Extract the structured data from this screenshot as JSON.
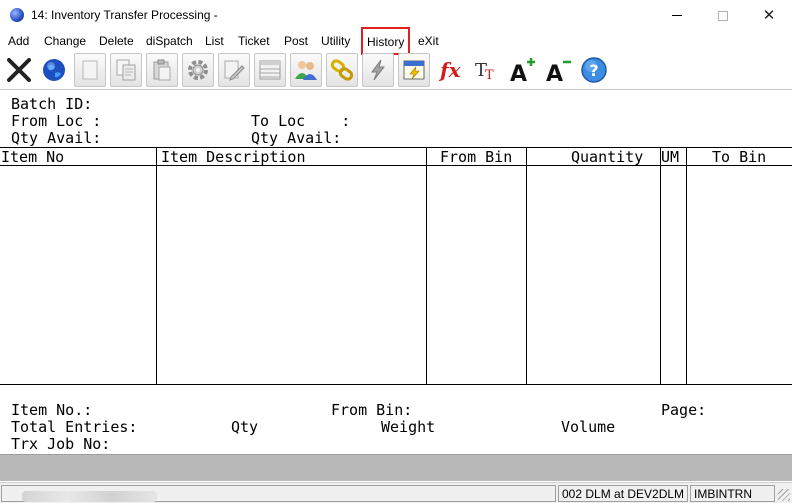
{
  "window": {
    "title": "14: Inventory Transfer Processing -",
    "minimize": "",
    "maximize": "",
    "close": "✕"
  },
  "menu": {
    "items": [
      {
        "label": "Add"
      },
      {
        "label": "Change"
      },
      {
        "label": "Delete"
      },
      {
        "label": "diSpatch"
      },
      {
        "label": "List"
      },
      {
        "label": "Ticket"
      },
      {
        "label": "Post"
      },
      {
        "label": "Utility"
      },
      {
        "label": "History",
        "highlighted": true
      },
      {
        "label": "eXit"
      }
    ]
  },
  "toolbar": {
    "buttons": [
      {
        "icon": "close-x-icon"
      },
      {
        "icon": "globe-icon"
      },
      {
        "icon": "blank-page-icon"
      },
      {
        "icon": "copy-icon"
      },
      {
        "icon": "paste-icon"
      },
      {
        "icon": "settings-gear-icon"
      },
      {
        "icon": "edit-pencil-icon"
      },
      {
        "icon": "grid-list-icon"
      },
      {
        "icon": "users-icon"
      },
      {
        "icon": "link-chain-icon"
      },
      {
        "icon": "lightning-icon"
      },
      {
        "icon": "calendar-lightning-icon"
      },
      {
        "icon": "function-fx-icon"
      },
      {
        "icon": "font-tt-icon"
      },
      {
        "icon": "font-increase-icon"
      },
      {
        "icon": "font-decrease-icon"
      },
      {
        "icon": "help-icon"
      }
    ],
    "help_glyph": "?"
  },
  "header_fields": {
    "batch_id": "Batch ID:",
    "from_loc": "From Loc :",
    "to_loc": "To Loc    :",
    "qty_avail_left": "Qty Avail:",
    "qty_avail_right": "Qty Avail:"
  },
  "grid": {
    "columns": [
      {
        "label": "Item No"
      },
      {
        "label": "Item Description"
      },
      {
        "label": "From Bin"
      },
      {
        "label": "Quantity"
      },
      {
        "label": "UM"
      },
      {
        "label": "To Bin"
      }
    ],
    "rows": []
  },
  "footer_fields": {
    "item_no": "Item No.:",
    "from_bin": "From Bin:",
    "page": "Page:",
    "total_entries": "Total Entries:",
    "qty": "Qty",
    "weight": "Weight",
    "volume": "Volume",
    "trx_job_no": "Trx Job No:"
  },
  "status_bar": {
    "session": "002 DLM at DEV2DLM",
    "program": "IMBINTRN"
  },
  "colors": {
    "highlight_border": "#e02020",
    "gray_band": "#b9b9b9"
  }
}
